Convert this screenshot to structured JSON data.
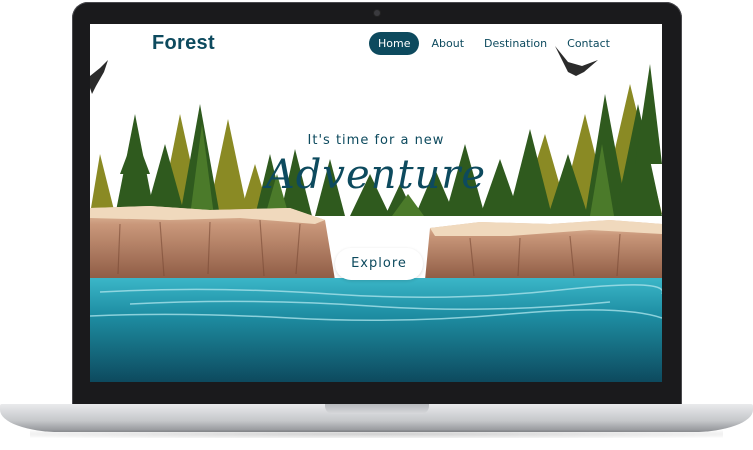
{
  "site": {
    "brand": "Forest",
    "nav": [
      {
        "label": "Home",
        "active": true
      },
      {
        "label": "About",
        "active": false
      },
      {
        "label": "Destination",
        "active": false
      },
      {
        "label": "Contact",
        "active": false
      }
    ],
    "hero": {
      "tagline": "It's time for a new",
      "headline": "Adventure",
      "cta": "Explore"
    }
  },
  "colors": {
    "brand": "#0d4a5e",
    "water": "#1e8ea3",
    "pine": "#2f5a1e",
    "cliff": "#b37a5a"
  }
}
